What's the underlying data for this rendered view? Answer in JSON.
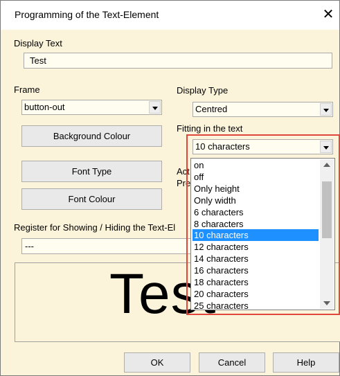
{
  "window": {
    "title": "Programming of the Text-Element",
    "close_label": "✕"
  },
  "display_text": {
    "label": "Display Text",
    "value": "Test"
  },
  "frame": {
    "label": "Frame",
    "selected": "button-out"
  },
  "display_type": {
    "label": "Display Type",
    "selected": "Centred"
  },
  "fitting": {
    "label": "Fitting in the text",
    "selected": "10 characters",
    "selected_index": 6,
    "scroll_position": 0.15,
    "options": [
      "on",
      "off",
      "Only height",
      "Only width",
      "6 characters",
      "8 characters",
      "10 characters",
      "12 characters",
      "14 characters",
      "16 characters",
      "18 characters",
      "20 characters",
      "25 characters"
    ]
  },
  "buttons": {
    "background_colour": "Background Colour",
    "font_type": "Font Type",
    "font_colour": "Font Colour",
    "ok": "OK",
    "cancel": "Cancel",
    "help": "Help"
  },
  "partial_labels": {
    "act": "Act",
    "pre": "Pre"
  },
  "register": {
    "label": "Register for Showing / Hiding the Text-El",
    "value": "---"
  },
  "preview": {
    "text": "Test"
  },
  "colors": {
    "dialog_bg": "#fbf4da",
    "selection": "#1e90ff",
    "highlight_border": "#e0463c"
  }
}
